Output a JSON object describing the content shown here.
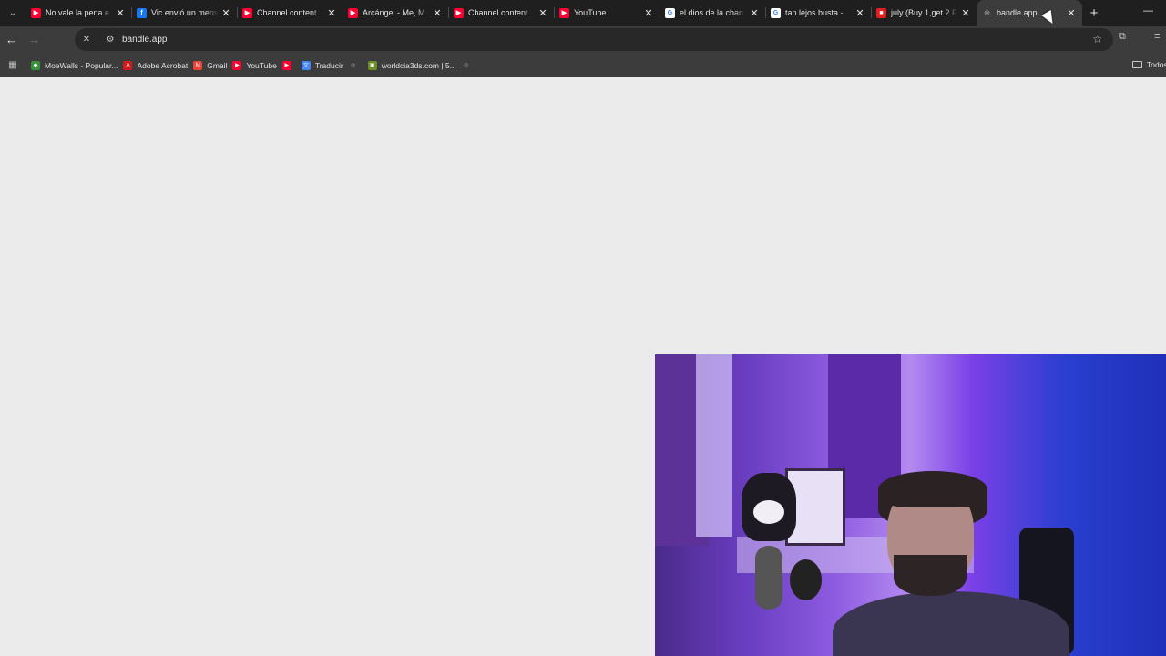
{
  "tabs": [
    {
      "title": "No vale la pena e",
      "icon": "youtube-icon",
      "color": "#ff0033"
    },
    {
      "title": "Vic envió un mensaje",
      "icon": "facebook-icon",
      "color": "#1877f2"
    },
    {
      "title": "Channel content",
      "icon": "youtube-icon",
      "color": "#ff0033"
    },
    {
      "title": "Arcángel - Me, M",
      "icon": "youtube-icon",
      "color": "#ff0033"
    },
    {
      "title": "Channel content",
      "icon": "youtube-icon",
      "color": "#ff0033"
    },
    {
      "title": "YouTube",
      "icon": "youtube-icon",
      "color": "#ff0033"
    },
    {
      "title": "el dios de la chan",
      "icon": "google-icon",
      "color": "#ffffff"
    },
    {
      "title": "tan lejos busta - ",
      "icon": "google-icon",
      "color": "#ffffff"
    },
    {
      "title": "july (Buy 1,get 2 F",
      "icon": "bandcamp-icon",
      "color": "#e02020"
    },
    {
      "title": "bandle.app",
      "icon": "globe-icon",
      "color": "#9aa0a6",
      "active": true
    }
  ],
  "toolbar": {
    "url": "bandle.app"
  },
  "bookmarks": [
    {
      "label": "MoeWalls - Popular...",
      "icon": "moewalls-icon",
      "color": "#3a8f3a"
    },
    {
      "label": "Adobe Acrobat",
      "icon": "acrobat-icon",
      "color": "#d11a1a"
    },
    {
      "label": "Gmail",
      "icon": "gmail-icon",
      "color": "#ea4335"
    },
    {
      "label": "YouTube",
      "icon": "youtube-icon",
      "color": "#ff0033"
    },
    {
      "label": "",
      "icon": "youtube-icon",
      "color": "#ff0033"
    },
    {
      "label": "Traducir",
      "icon": "translate-icon",
      "color": "#4285f4"
    },
    {
      "label": "",
      "icon": "globe-icon",
      "color": "#9aa0a6"
    },
    {
      "label": "worldcia3ds.com | 5...",
      "icon": "worldcia-icon",
      "color": "#6a8f2a"
    },
    {
      "label": "",
      "icon": "globe-icon",
      "color": "#9aa0a6"
    }
  ],
  "bookmarks_folder": "Todos"
}
